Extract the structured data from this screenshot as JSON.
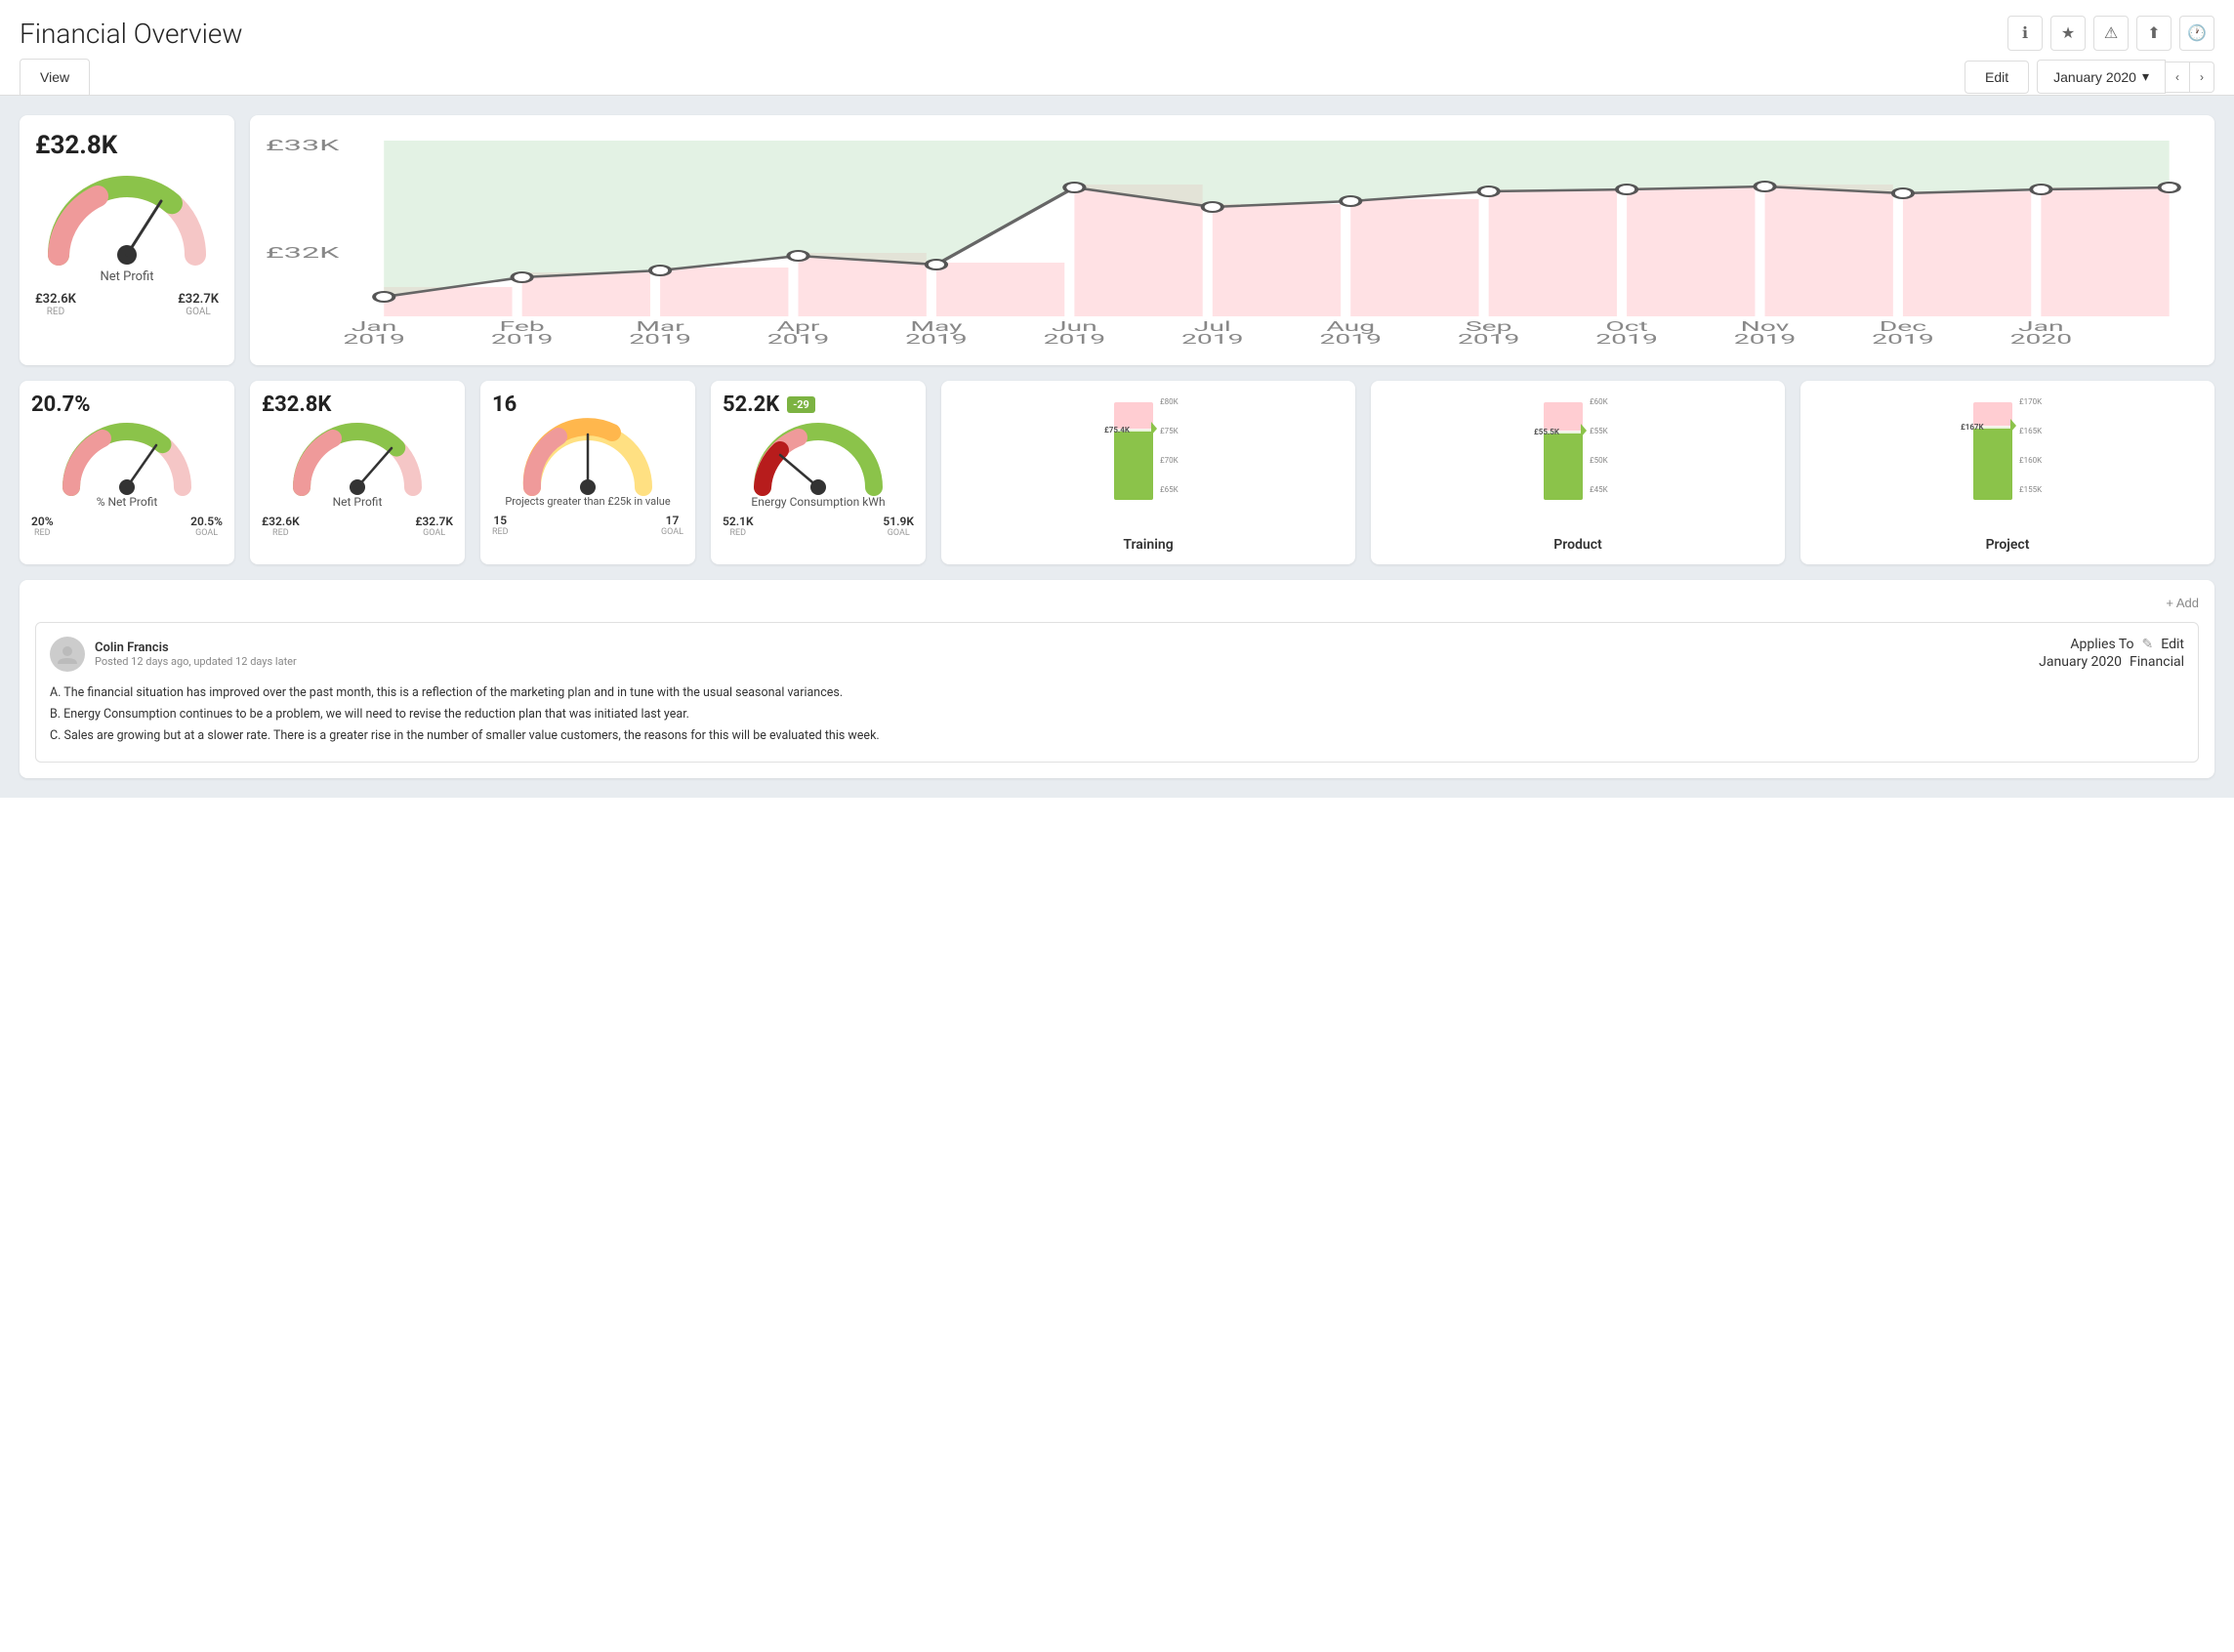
{
  "header": {
    "title": "Financial Overview",
    "icons": [
      "info-icon",
      "star-icon",
      "alert-icon",
      "export-icon",
      "clock-icon"
    ]
  },
  "toolbar": {
    "view_tab": "View",
    "edit_btn": "Edit",
    "date_label": "January 2020"
  },
  "top_gauge": {
    "value": "£32.8K",
    "label": "Net Profit",
    "red_val": "£32.6K",
    "red_label": "RED",
    "goal_val": "£32.7K",
    "goal_label": "GOAL"
  },
  "chart": {
    "y_labels": [
      "£33K",
      "£32K"
    ],
    "x_labels": [
      "Jan\n2019",
      "Feb\n2019",
      "Mar\n2019",
      "Apr\n2019",
      "May\n2019",
      "Jun\n2019",
      "Jul\n2019",
      "Aug\n2019",
      "Sep\n2019",
      "Oct\n2019",
      "Nov\n2019",
      "Dec\n2019",
      "Jan\n2020"
    ]
  },
  "cards": [
    {
      "id": "pct-net-profit",
      "value": "20.7%",
      "label": "% Net Profit",
      "red_val": "20%",
      "red_label": "RED",
      "goal_val": "20.5%",
      "goal_label": "GOAL",
      "type": "gauge",
      "gauge_pct": 0.65
    },
    {
      "id": "net-profit-2",
      "value": "£32.8K",
      "label": "Net Profit",
      "red_val": "£32.6K",
      "red_label": "RED",
      "goal_val": "£32.7K",
      "goal_label": "GOAL",
      "type": "gauge",
      "gauge_pct": 0.72
    },
    {
      "id": "projects",
      "value": "16",
      "label": "Projects greater than £25k in value",
      "red_val": "15",
      "red_label": "RED",
      "goal_val": "17",
      "goal_label": "GOAL",
      "type": "gauge",
      "gauge_pct": 0.5
    },
    {
      "id": "energy",
      "value": "52.2K",
      "badge": "-29",
      "label": "Energy Consumption kWh",
      "red_val": "52.1K",
      "red_label": "RED",
      "goal_val": "51.9K",
      "goal_label": "GOAL",
      "type": "gauge_red",
      "gauge_pct": 0.15
    }
  ],
  "bar_cards": [
    {
      "id": "training",
      "label": "Training",
      "current": 75.4,
      "goal": 80,
      "current_label": "£75.4K",
      "y_labels": [
        "£80K",
        "£75K",
        "£70K",
        "£65K"
      ]
    },
    {
      "id": "product",
      "label": "Product",
      "current": 55.5,
      "goal": 60,
      "current_label": "£55.5K",
      "y_labels": [
        "£60K",
        "£55K",
        "£50K",
        "£45K"
      ]
    },
    {
      "id": "project",
      "label": "Project",
      "current": 167,
      "goal": 170,
      "current_label": "£167K",
      "y_labels": [
        "£170K",
        "£165K",
        "£160K",
        "£155K"
      ]
    }
  ],
  "comments": {
    "add_btn": "+ Add",
    "items": [
      {
        "author": "Colin Francis",
        "posted": "Posted 12 days ago, updated 12 days later",
        "applies_to_label": "Applies To",
        "applies_to_date": "January 2020",
        "edit_label": "Edit",
        "financial_label": "Financial",
        "body": [
          "A. The financial situation has improved over the past month, this is a reflection of the marketing plan and in tune with the usual seasonal variances.",
          "B. Energy Consumption continues to be a problem, we will need to revise the reduction plan that was initiated last year.",
          "C. Sales are growing but at a slower rate. There is a greater rise in the number of smaller value customers, the reasons for this will be evaluated this week."
        ]
      }
    ]
  }
}
